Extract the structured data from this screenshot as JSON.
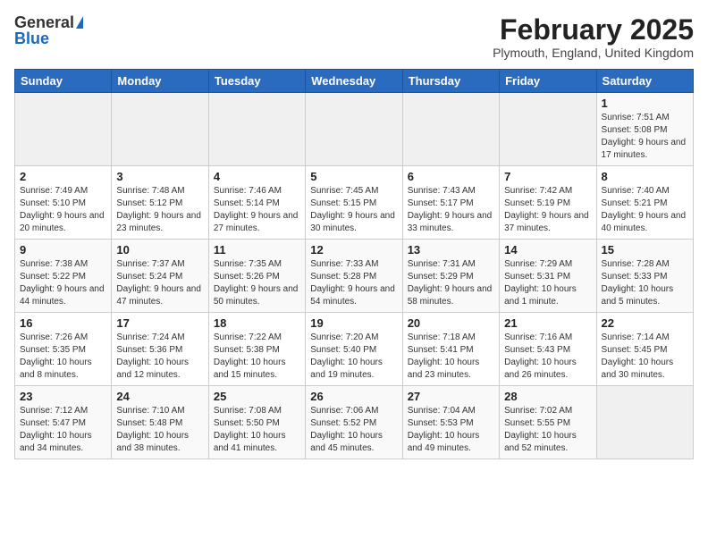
{
  "header": {
    "logo_general": "General",
    "logo_blue": "Blue",
    "month_title": "February 2025",
    "location": "Plymouth, England, United Kingdom"
  },
  "weekdays": [
    "Sunday",
    "Monday",
    "Tuesday",
    "Wednesday",
    "Thursday",
    "Friday",
    "Saturday"
  ],
  "weeks": [
    [
      {
        "day": "",
        "info": ""
      },
      {
        "day": "",
        "info": ""
      },
      {
        "day": "",
        "info": ""
      },
      {
        "day": "",
        "info": ""
      },
      {
        "day": "",
        "info": ""
      },
      {
        "day": "",
        "info": ""
      },
      {
        "day": "1",
        "info": "Sunrise: 7:51 AM\nSunset: 5:08 PM\nDaylight: 9 hours and 17 minutes."
      }
    ],
    [
      {
        "day": "2",
        "info": "Sunrise: 7:49 AM\nSunset: 5:10 PM\nDaylight: 9 hours and 20 minutes."
      },
      {
        "day": "3",
        "info": "Sunrise: 7:48 AM\nSunset: 5:12 PM\nDaylight: 9 hours and 23 minutes."
      },
      {
        "day": "4",
        "info": "Sunrise: 7:46 AM\nSunset: 5:14 PM\nDaylight: 9 hours and 27 minutes."
      },
      {
        "day": "5",
        "info": "Sunrise: 7:45 AM\nSunset: 5:15 PM\nDaylight: 9 hours and 30 minutes."
      },
      {
        "day": "6",
        "info": "Sunrise: 7:43 AM\nSunset: 5:17 PM\nDaylight: 9 hours and 33 minutes."
      },
      {
        "day": "7",
        "info": "Sunrise: 7:42 AM\nSunset: 5:19 PM\nDaylight: 9 hours and 37 minutes."
      },
      {
        "day": "8",
        "info": "Sunrise: 7:40 AM\nSunset: 5:21 PM\nDaylight: 9 hours and 40 minutes."
      }
    ],
    [
      {
        "day": "9",
        "info": "Sunrise: 7:38 AM\nSunset: 5:22 PM\nDaylight: 9 hours and 44 minutes."
      },
      {
        "day": "10",
        "info": "Sunrise: 7:37 AM\nSunset: 5:24 PM\nDaylight: 9 hours and 47 minutes."
      },
      {
        "day": "11",
        "info": "Sunrise: 7:35 AM\nSunset: 5:26 PM\nDaylight: 9 hours and 50 minutes."
      },
      {
        "day": "12",
        "info": "Sunrise: 7:33 AM\nSunset: 5:28 PM\nDaylight: 9 hours and 54 minutes."
      },
      {
        "day": "13",
        "info": "Sunrise: 7:31 AM\nSunset: 5:29 PM\nDaylight: 9 hours and 58 minutes."
      },
      {
        "day": "14",
        "info": "Sunrise: 7:29 AM\nSunset: 5:31 PM\nDaylight: 10 hours and 1 minute."
      },
      {
        "day": "15",
        "info": "Sunrise: 7:28 AM\nSunset: 5:33 PM\nDaylight: 10 hours and 5 minutes."
      }
    ],
    [
      {
        "day": "16",
        "info": "Sunrise: 7:26 AM\nSunset: 5:35 PM\nDaylight: 10 hours and 8 minutes."
      },
      {
        "day": "17",
        "info": "Sunrise: 7:24 AM\nSunset: 5:36 PM\nDaylight: 10 hours and 12 minutes."
      },
      {
        "day": "18",
        "info": "Sunrise: 7:22 AM\nSunset: 5:38 PM\nDaylight: 10 hours and 15 minutes."
      },
      {
        "day": "19",
        "info": "Sunrise: 7:20 AM\nSunset: 5:40 PM\nDaylight: 10 hours and 19 minutes."
      },
      {
        "day": "20",
        "info": "Sunrise: 7:18 AM\nSunset: 5:41 PM\nDaylight: 10 hours and 23 minutes."
      },
      {
        "day": "21",
        "info": "Sunrise: 7:16 AM\nSunset: 5:43 PM\nDaylight: 10 hours and 26 minutes."
      },
      {
        "day": "22",
        "info": "Sunrise: 7:14 AM\nSunset: 5:45 PM\nDaylight: 10 hours and 30 minutes."
      }
    ],
    [
      {
        "day": "23",
        "info": "Sunrise: 7:12 AM\nSunset: 5:47 PM\nDaylight: 10 hours and 34 minutes."
      },
      {
        "day": "24",
        "info": "Sunrise: 7:10 AM\nSunset: 5:48 PM\nDaylight: 10 hours and 38 minutes."
      },
      {
        "day": "25",
        "info": "Sunrise: 7:08 AM\nSunset: 5:50 PM\nDaylight: 10 hours and 41 minutes."
      },
      {
        "day": "26",
        "info": "Sunrise: 7:06 AM\nSunset: 5:52 PM\nDaylight: 10 hours and 45 minutes."
      },
      {
        "day": "27",
        "info": "Sunrise: 7:04 AM\nSunset: 5:53 PM\nDaylight: 10 hours and 49 minutes."
      },
      {
        "day": "28",
        "info": "Sunrise: 7:02 AM\nSunset: 5:55 PM\nDaylight: 10 hours and 52 minutes."
      },
      {
        "day": "",
        "info": ""
      }
    ]
  ]
}
